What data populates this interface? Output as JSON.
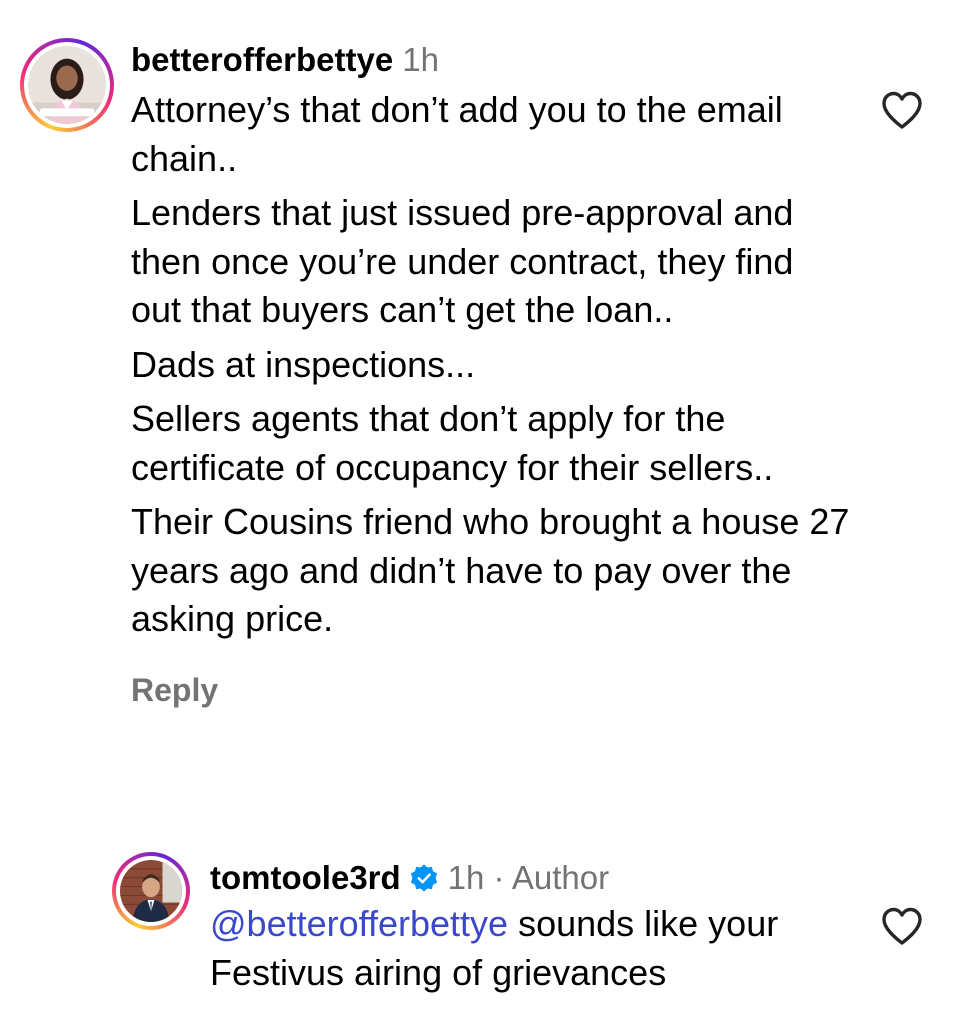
{
  "comments": [
    {
      "username": "betterofferbettye",
      "time": "1h",
      "paragraphs": [
        "Attorney’s that don’t add you to the email chain..",
        "Lenders that just issued pre-approval and then once you’re under contract, they find out that buyers can’t get the loan..",
        "Dads at inspections...",
        "Sellers agents that don’t apply for the certificate of occupancy for their sellers..",
        "Their Cousins friend who brought a house 27 years ago and didn’t have to pay over the asking price."
      ],
      "reply_label": "Reply",
      "like_icon": "heart-outline-icon"
    },
    {
      "username": "tomtoole3rd",
      "verified": true,
      "meta": "1h · Author",
      "mention": "@betterofferbettye",
      "body": " sounds like your Festivus airing of grievances",
      "like_icon": "heart-outline-icon"
    }
  ],
  "colors": {
    "text": "#000000",
    "meta": "#737373",
    "mention": "#3a49c9",
    "verified": "#0095f6",
    "story_ring_start": "#f9ce34",
    "story_ring_mid": "#ee2a7b",
    "story_ring_end": "#6228d7"
  }
}
